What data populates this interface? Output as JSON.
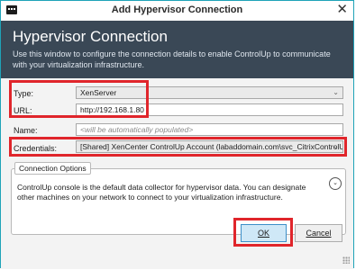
{
  "window": {
    "title": "Add Hypervisor Connection",
    "close_glyph": "✕"
  },
  "header": {
    "title": "Hypervisor Connection",
    "description": "Use this window to configure the connection details to enable ControlUp to communicate with your virtualization infrastructure."
  },
  "form": {
    "type_label": "Type:",
    "type_value": "XenServer",
    "url_label": "URL:",
    "url_value": "http://192.168.1.80",
    "name_label": "Name:",
    "name_placeholder": "<will be automatically populated>",
    "credentials_label": "Credentials:",
    "credentials_value": "[Shared] XenCenter ControlUp  Account (labaddomain.com\\svc_CitrixControlUp)"
  },
  "connection_options": {
    "title": "Connection Options",
    "body": "ControlUp console is the default data collector for hypervisor data. You can designate other machines on your network to connect to your virtualization infrastructure.",
    "expand_icon": "chevron-down-circle-icon"
  },
  "buttons": {
    "ok": "OK",
    "cancel": "Cancel"
  },
  "colors": {
    "header_bg": "#3a4856",
    "highlight": "#e0252b",
    "ok_bg": "#cfe8f7"
  }
}
